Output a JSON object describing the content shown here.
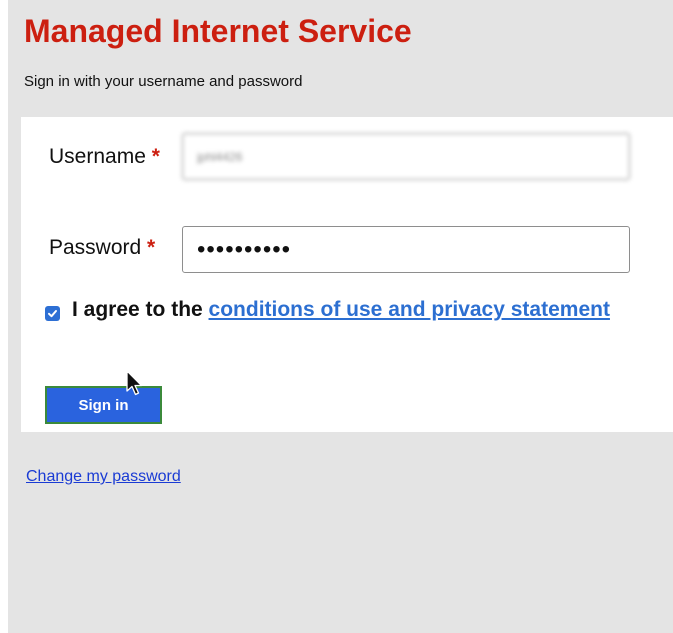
{
  "page": {
    "title": "Managed Internet Service",
    "subtitle": "Sign in with your username and password"
  },
  "form": {
    "username_label": "Username",
    "username_value": "jphl4426",
    "password_label": "Password",
    "password_value": "••••••••••",
    "required_marker": "*",
    "agree_prefix": "I agree to the ",
    "agree_link": "conditions of use and privacy statement",
    "agree_checked": true,
    "signin_label": "Sign in"
  },
  "links": {
    "change_password": "Change my password"
  },
  "colors": {
    "title": "#cc1f10",
    "link": "#2c6fd1",
    "button": "#2a63de",
    "background": "#e4e4e4"
  },
  "icons": {
    "cursor": "mouse-pointer-icon",
    "checkbox": "checkmark-icon"
  }
}
